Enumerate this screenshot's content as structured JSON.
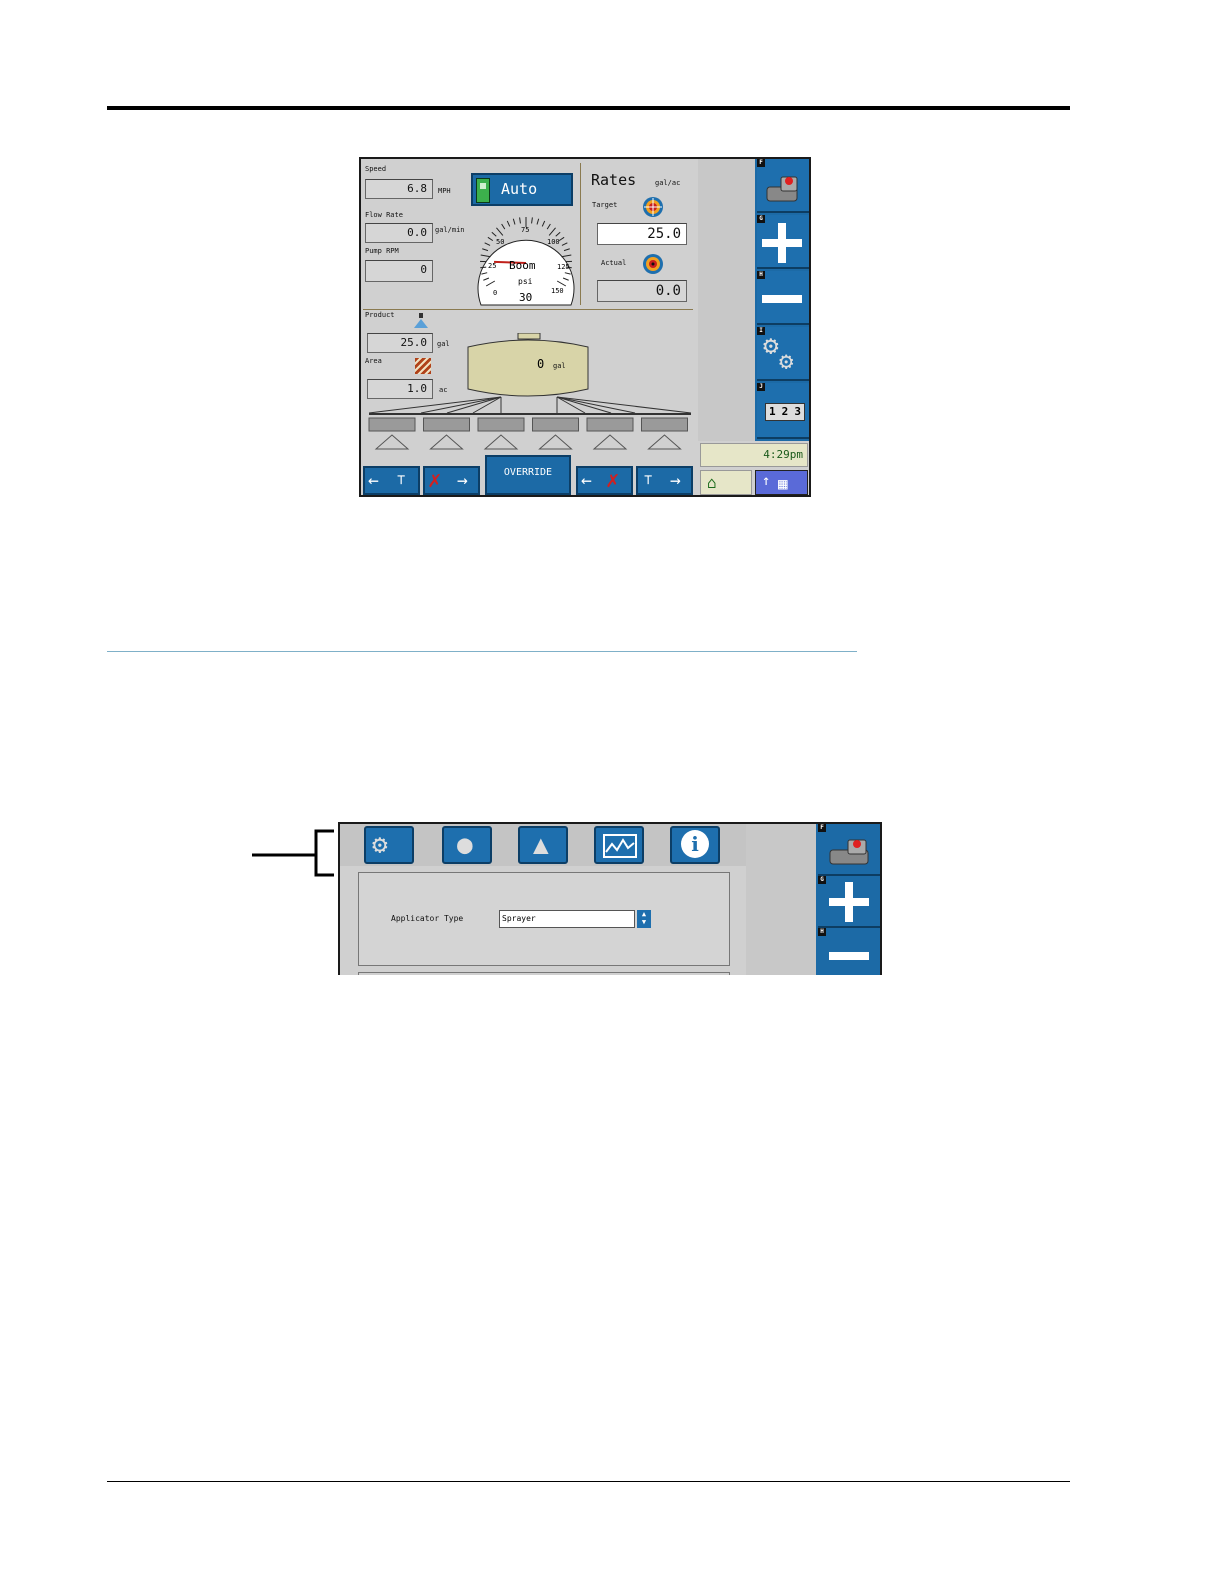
{
  "screen1": {
    "speed": {
      "label": "Speed",
      "value": "6.8",
      "unit": "MPH"
    },
    "mode_button": "Auto",
    "flow_rate": {
      "label": "Flow Rate",
      "value": "0.0",
      "unit": "gal/min"
    },
    "pump_rpm": {
      "label": "Pump RPM",
      "value": "0"
    },
    "gauge": {
      "title": "Boom",
      "unit": "psi",
      "reading": "30",
      "ticks": [
        "0",
        "25",
        "50",
        "75",
        "100",
        "125",
        "150"
      ],
      "needle_value": 20
    },
    "rates": {
      "title": "Rates",
      "unit": "gal/ac",
      "target_label": "Target",
      "target_value": "25.0",
      "actual_label": "Actual",
      "actual_value": "0.0"
    },
    "product": {
      "label": "Product",
      "value": "25.0",
      "unit": "gal"
    },
    "area": {
      "label": "Area",
      "value": "1.0",
      "unit": "ac"
    },
    "tank": {
      "value": "0",
      "unit": "gal"
    },
    "override_button": "OVERRIDE",
    "clock": "4:29pm",
    "side_keys": [
      "F",
      "G",
      "H",
      "I",
      "J"
    ],
    "counter_digits": [
      "1",
      "2",
      "3"
    ]
  },
  "screen2": {
    "applicator_label": "Applicator Type",
    "applicator_value": "Sprayer",
    "side_keys": [
      "F",
      "G",
      "H"
    ],
    "tabs": [
      "settings-tab",
      "product-tab",
      "alarms-tab",
      "diagnostics-tab",
      "info-tab"
    ]
  },
  "colors": {
    "panel_blue": "#1c6aa6",
    "screen_gray": "#d0d0d0",
    "tank": "#d8d4a8",
    "clock_bg": "#e6e6c8"
  }
}
